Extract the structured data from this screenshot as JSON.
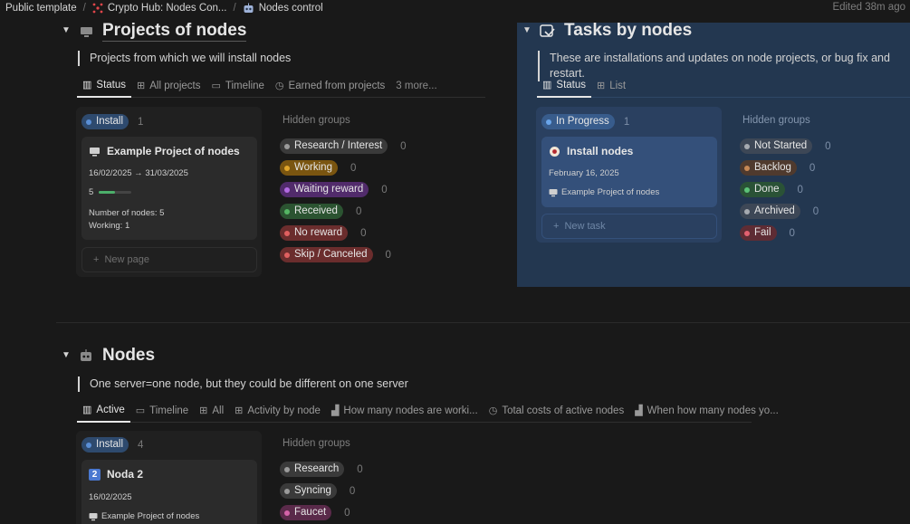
{
  "breadcrumb": {
    "items": [
      {
        "label": "Public template"
      },
      {
        "label": "Crypto Hub: Nodes Con..."
      },
      {
        "label": "Nodes control"
      }
    ],
    "edited": "Edited 38m ago"
  },
  "projects": {
    "title": "Projects of nodes",
    "description": "Projects from which we will install nodes",
    "tabs": [
      {
        "label": "Status",
        "icon": "board-icon"
      },
      {
        "label": "All projects",
        "icon": "table-icon"
      },
      {
        "label": "Timeline",
        "icon": "timeline-icon"
      },
      {
        "label": "Earned from projects",
        "icon": "clock-icon"
      }
    ],
    "more_tabs": "3 more...",
    "column": {
      "label": "Install",
      "count": "1",
      "color": "#2e4a6e"
    },
    "card": {
      "title": "Example Project of nodes",
      "dates": "16/02/2025 → 31/03/2025",
      "progress_value": "5",
      "progress_fraction": 0.5,
      "nodes": "Number of nodes: 5",
      "working": "Working: 1"
    },
    "new_label": "New page",
    "hidden_title": "Hidden groups",
    "hidden_groups": [
      {
        "label": "Research / Interest",
        "count": "0",
        "bg": "#3a3a3a",
        "dot": "#9b9b9b"
      },
      {
        "label": "Working",
        "count": "0",
        "bg": "#7a5510",
        "dot": "#e0a52a"
      },
      {
        "label": "Waiting reward",
        "count": "0",
        "bg": "#512b6b",
        "dot": "#b36ae2"
      },
      {
        "label": "Received",
        "count": "0",
        "bg": "#2b5331",
        "dot": "#55b564"
      },
      {
        "label": "No reward",
        "count": "0",
        "bg": "#6b2d2d",
        "dot": "#e06060"
      },
      {
        "label": "Skip / Canceled",
        "count": "0",
        "bg": "#6b2d2d",
        "dot": "#e06060"
      }
    ]
  },
  "tasks": {
    "title": "Tasks by nodes",
    "description": "These are installations and updates on node projects, or bug fix and restart.",
    "tabs": [
      {
        "label": "Status",
        "icon": "board-icon"
      },
      {
        "label": "List",
        "icon": "table-icon"
      }
    ],
    "column": {
      "label": "In Progress",
      "count": "1"
    },
    "card": {
      "title": "Install nodes",
      "date": "February 16, 2025",
      "project": "Example Project of nodes"
    },
    "new_label": "New task",
    "hidden_title": "Hidden groups",
    "hidden_groups": [
      {
        "label": "Not Started",
        "count": "0",
        "bg": "#3d4756",
        "dot": "#a6aab0"
      },
      {
        "label": "Backlog",
        "count": "0",
        "bg": "#4f3a2e",
        "dot": "#c68855"
      },
      {
        "label": "Done",
        "count": "0",
        "bg": "#2a5236",
        "dot": "#5cc277"
      },
      {
        "label": "Archived",
        "count": "0",
        "bg": "#3d4756",
        "dot": "#a6aab0"
      },
      {
        "label": "Fail",
        "count": "0",
        "bg": "#5e2c34",
        "dot": "#e26070"
      }
    ]
  },
  "nodes": {
    "title": "Nodes",
    "description": "One server=one node, but they could be different on one server",
    "tabs": [
      {
        "label": "Active",
        "icon": "board-icon"
      },
      {
        "label": "Timeline",
        "icon": "timeline-icon"
      },
      {
        "label": "All",
        "icon": "table-icon"
      },
      {
        "label": "Activity by node",
        "icon": "table-icon"
      },
      {
        "label": "How many nodes are worki...",
        "icon": "bar-chart-icon"
      },
      {
        "label": "Total costs of active nodes",
        "icon": "clock-icon"
      },
      {
        "label": "When how many nodes yo...",
        "icon": "bar-chart-icon"
      }
    ],
    "column": {
      "label": "Install",
      "count": "4"
    },
    "card": {
      "badge": "2",
      "title": "Noda 2",
      "date": "16/02/2025",
      "project": "Example Project of nodes"
    },
    "hidden_title": "Hidden groups",
    "hidden_groups": [
      {
        "label": "Research",
        "count": "0",
        "bg": "#3a3a3a",
        "dot": "#9b9b9b"
      },
      {
        "label": "Syncing",
        "count": "0",
        "bg": "#3a3a3a",
        "dot": "#9b9b9b"
      },
      {
        "label": "Faucet",
        "count": "0",
        "bg": "#5a2a4a",
        "dot": "#d463a8"
      }
    ]
  }
}
